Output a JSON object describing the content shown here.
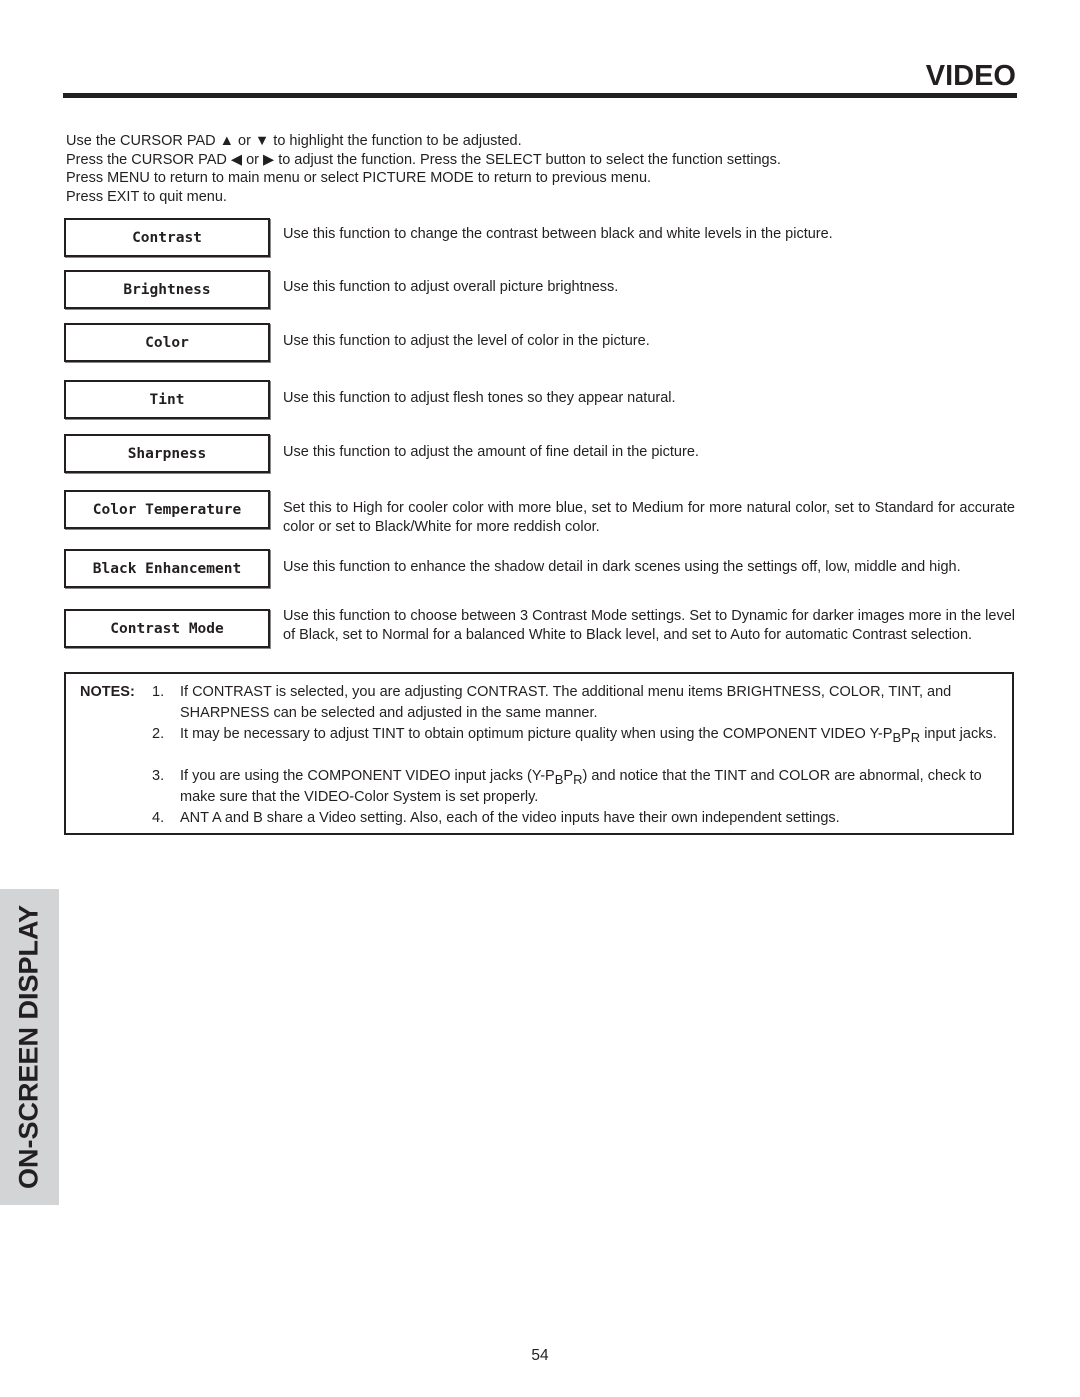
{
  "header": {
    "title": "VIDEO"
  },
  "intro": {
    "lines": [
      "Use the CURSOR PAD ▲ or ▼ to highlight the function to be adjusted.",
      "Press the CURSOR PAD ◀ or ▶ to adjust the function.  Press the SELECT button to select the function settings.",
      "Press MENU to return to main menu or select PICTURE MODE to return to previous menu.",
      "Press EXIT to quit menu."
    ]
  },
  "menu_items": [
    {
      "label": "Contrast",
      "description": "Use this function to change the contrast between black and white levels in the picture."
    },
    {
      "label": "Brightness",
      "description": "Use this function to adjust overall picture brightness."
    },
    {
      "label": "Color",
      "description": "Use this function to adjust the level of color in the picture."
    },
    {
      "label": "Tint",
      "description": "Use this function to adjust flesh tones so they appear natural."
    },
    {
      "label": "Sharpness",
      "description": "Use this function to adjust the amount of fine detail in the picture."
    },
    {
      "label": "Color Temperature",
      "description": "Set this to High for cooler color with more blue, set to Medium for more natural color, set to Standard for accurate color or set to Black/White for more reddish color."
    },
    {
      "label": "Black Enhancement",
      "description": "Use this function to enhance the shadow detail in dark scenes using the settings off, low, middle and high."
    },
    {
      "label": "Contrast Mode",
      "description": "Use this function to choose between 3 Contrast Mode settings.  Set to Dynamic for darker images more in the level of Black, set to Normal for a balanced White to Black level, and set to Auto for automatic Contrast selection."
    }
  ],
  "notes": {
    "label": "NOTES:",
    "items": [
      {
        "num": "1.",
        "text": "If CONTRAST is selected, you are adjusting CONTRAST.  The additional menu items BRIGHTNESS, COLOR, TINT, and SHARPNESS can be selected and adjusted in the same manner."
      },
      {
        "num": "2.",
        "text_before": "It may be necessary to adjust TINT to obtain optimum picture quality when using the COMPONENT VIDEO Y-P",
        "sub1": "B",
        "mid": "P",
        "sub2": "R",
        "text_after": " input jacks."
      },
      {
        "num": "3.",
        "text_before": "If you are using the COMPONENT VIDEO input jacks (Y-P",
        "sub1": "B",
        "mid": "P",
        "sub2": "R",
        "text_after": ") and notice that the TINT and COLOR are abnormal, check to make sure that the VIDEO-Color System is set properly."
      },
      {
        "num": "4.",
        "text": "ANT A and B share a Video setting.  Also, each of the video inputs have their own independent settings."
      }
    ]
  },
  "side_tab": {
    "label": "ON-SCREEN DISPLAY",
    "background": "#d3d4d6"
  },
  "footer": {
    "page_number": "54"
  }
}
